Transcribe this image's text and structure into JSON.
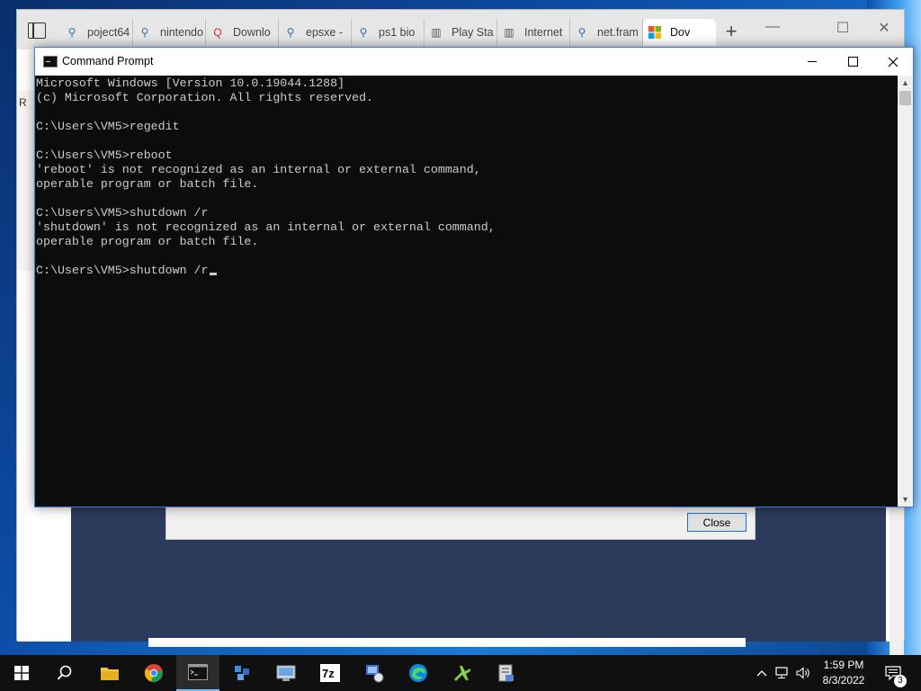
{
  "browser": {
    "tabs": [
      {
        "label": "poject64",
        "icon": "search-icon",
        "active": false
      },
      {
        "label": "nintendo",
        "icon": "search-icon",
        "active": false
      },
      {
        "label": "Downlo",
        "icon": "quora-icon",
        "active": false
      },
      {
        "label": "epsxe -",
        "icon": "search-icon",
        "active": false
      },
      {
        "label": "ps1 bio",
        "icon": "search-icon",
        "active": false
      },
      {
        "label": "Play Sta",
        "icon": "archive-icon",
        "active": false
      },
      {
        "label": "Internet",
        "icon": "archive-icon",
        "active": false
      },
      {
        "label": "net.fram",
        "icon": "search-icon",
        "active": false
      },
      {
        "label": "Dov",
        "icon": "microsoft-icon",
        "active": true
      }
    ],
    "new_tab_symbol": "+",
    "left_strip_letter": "R",
    "dialog_close_label": "Close"
  },
  "cmd": {
    "title": "Command Prompt",
    "lines": [
      "Microsoft Windows [Version 10.0.19044.1288]",
      "(c) Microsoft Corporation. All rights reserved.",
      "",
      "C:\\Users\\VM5>regedit",
      "",
      "C:\\Users\\VM5>reboot",
      "'reboot' is not recognized as an internal or external command,",
      "operable program or batch file.",
      "",
      "C:\\Users\\VM5>shutdown /r",
      "'shutdown' is not recognized as an internal or external command,",
      "operable program or batch file.",
      "",
      "C:\\Users\\VM5>shutdown /r"
    ],
    "text_color": "#cccccc",
    "background": "#0c0c0c"
  },
  "taskbar": {
    "apps": [
      {
        "name": "file-explorer-icon",
        "active": false
      },
      {
        "name": "chrome-icon",
        "active": false
      },
      {
        "name": "command-prompt-icon",
        "active": true
      },
      {
        "name": "dependency-walker-icon",
        "active": false
      },
      {
        "name": "control-panel-icon",
        "active": false
      },
      {
        "name": "7zip-icon",
        "active": false
      },
      {
        "name": "network-tool-icon",
        "active": false
      },
      {
        "name": "edge-icon",
        "active": false
      },
      {
        "name": "plane-app-icon",
        "active": false
      },
      {
        "name": "installer-icon",
        "active": false
      }
    ],
    "time": "1:59 PM",
    "date": "8/3/2022",
    "notification_count": "3"
  }
}
